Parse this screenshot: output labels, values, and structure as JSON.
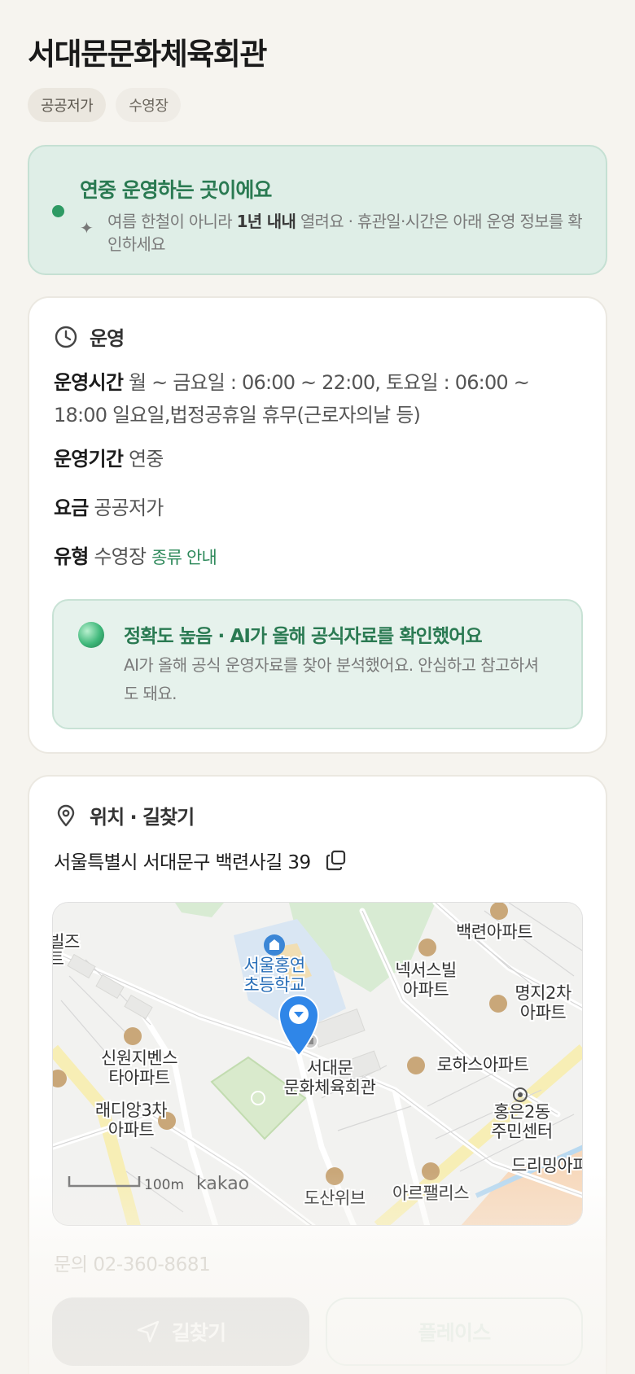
{
  "page": {
    "title": "서대문문화체육회관",
    "tags": [
      "공공저가",
      "수영장"
    ]
  },
  "notice": {
    "heading": "연중 운영하는 곳이에요",
    "body_pre": "여름 한철이 아니라 ",
    "body_bold": "1년 내내",
    "body_post": " 열려요 · 휴관일·시간은 아래 운영 정보를 확인하세요",
    "dot_color": "#2e9a64"
  },
  "operation": {
    "section_title": "운영",
    "hours_label": "운영시간",
    "hours_value": "월 ~ 금요일 : 06:00 ~ 22:00, 토요일 : 06:00 ~ 18:00 일요일,법정공휴일 휴무(근로자의날 등)",
    "period_label": "운영기간",
    "period_value": "연중",
    "fee_label": "요금",
    "fee_value": "공공저가",
    "type_label": "유형",
    "type_value": "수영장",
    "type_link": "종류 안내",
    "ai": {
      "title": "정확도 높음 · AI가 올해 공식자료를 확인했어요",
      "body": "AI가 올해 공식 운영자료를 찾아 분석했어요. 안심하고 참고하셔도 돼요."
    }
  },
  "location": {
    "section_title": "위치 · 길찾기",
    "address": "서울특별시 서대문구 백련사길 39",
    "map": {
      "labels": {
        "school_line1": "서울홍연",
        "school_line2": "초등학교",
        "venue_line1": "서대문",
        "venue_line2": "문화체육회관",
        "baekryeon": "백련아파트",
        "nexus_line1": "넥서스빌",
        "nexus_line2": "아파트",
        "myeongji_line1": "명지2차",
        "myeongji_line2": "아파트",
        "sinwon_line1": "신원지벤스",
        "sinwon_line2": "타아파트",
        "rohas": "로하스아파트",
        "radiang_line1": "래디앙3차",
        "radiang_line2": "아파트",
        "hongeun_line1": "홍은2동",
        "hongeun_line2": "주민센터",
        "dreaming": "드리밍아피",
        "dosan": "도산위브",
        "arte": "아르팰리스",
        "leftcut1": "빌즈",
        "leftcut2": "트",
        "scale": "100m",
        "brand": "kakao"
      }
    },
    "phone": "문의 02-360-8681",
    "navigate_button": "길찾기",
    "place_button": "플레이스"
  },
  "colors": {
    "accent_green": "#2a7a52",
    "marker_blue": "#2f86e8"
  }
}
